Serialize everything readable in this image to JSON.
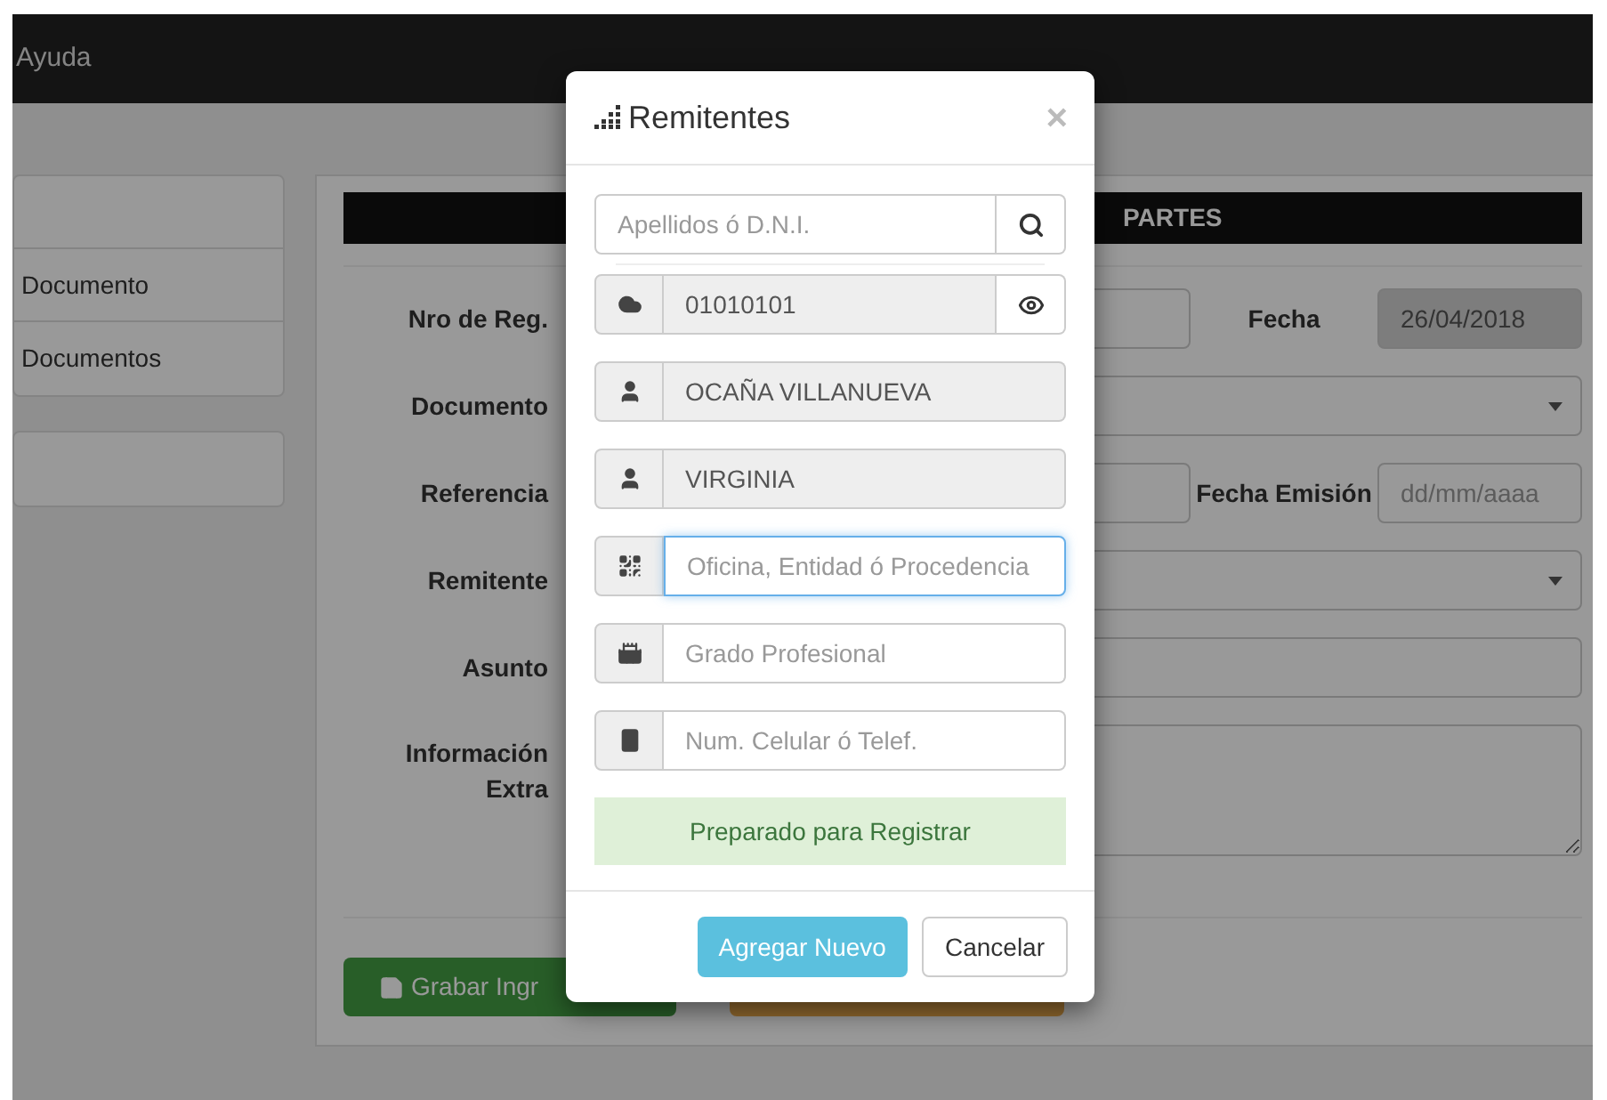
{
  "navbar": {
    "menu_item": "Ayuda"
  },
  "sidebar": {
    "items": [
      {
        "label": "Documento"
      },
      {
        "label": "Documentos"
      }
    ]
  },
  "panel": {
    "title": "PARTES",
    "rows": [
      {
        "kind": "pair",
        "label": "Nro de Reg.",
        "label2": "Fecha",
        "value2": "26/04/2018",
        "readonly2": true
      },
      {
        "kind": "select",
        "label": "Documento"
      },
      {
        "kind": "pair",
        "label": "Referencia",
        "label2": "Fecha Emisión",
        "placeholder2": "dd/mm/aaaa",
        "readonly2": false
      },
      {
        "kind": "select",
        "label": "Remitente"
      },
      {
        "kind": "input",
        "label": "Asunto"
      },
      {
        "kind": "textarea",
        "label": "Información Extra"
      }
    ],
    "save_button": {
      "label": "Grabar Ingr"
    }
  },
  "modal": {
    "title": "Remitentes",
    "close": "×",
    "search": {
      "placeholder": "Apellidos ó D.N.I."
    },
    "fields": [
      {
        "kind": "dni",
        "value": "01010101",
        "readonly": true,
        "focused": false,
        "eye": true
      },
      {
        "kind": "person",
        "value": "OCAÑA VILLANUEVA",
        "readonly": true,
        "focused": false,
        "eye": false
      },
      {
        "kind": "person",
        "value": "VIRGINIA",
        "readonly": true,
        "focused": false,
        "eye": false
      },
      {
        "kind": "office",
        "placeholder": "Oficina, Entidad ó Procedencia",
        "readonly": false,
        "focused": true,
        "eye": false
      },
      {
        "kind": "grade",
        "placeholder": "Grado Profesional",
        "readonly": false,
        "focused": false,
        "eye": false
      },
      {
        "kind": "phone",
        "placeholder": "Num. Celular ó Telef.",
        "readonly": false,
        "focused": false,
        "eye": false
      }
    ],
    "status": "Preparado para Registrar",
    "buttons": [
      {
        "kind": "primary",
        "label": "Agregar Nuevo"
      },
      {
        "kind": "default",
        "label": "Cancelar"
      }
    ]
  }
}
